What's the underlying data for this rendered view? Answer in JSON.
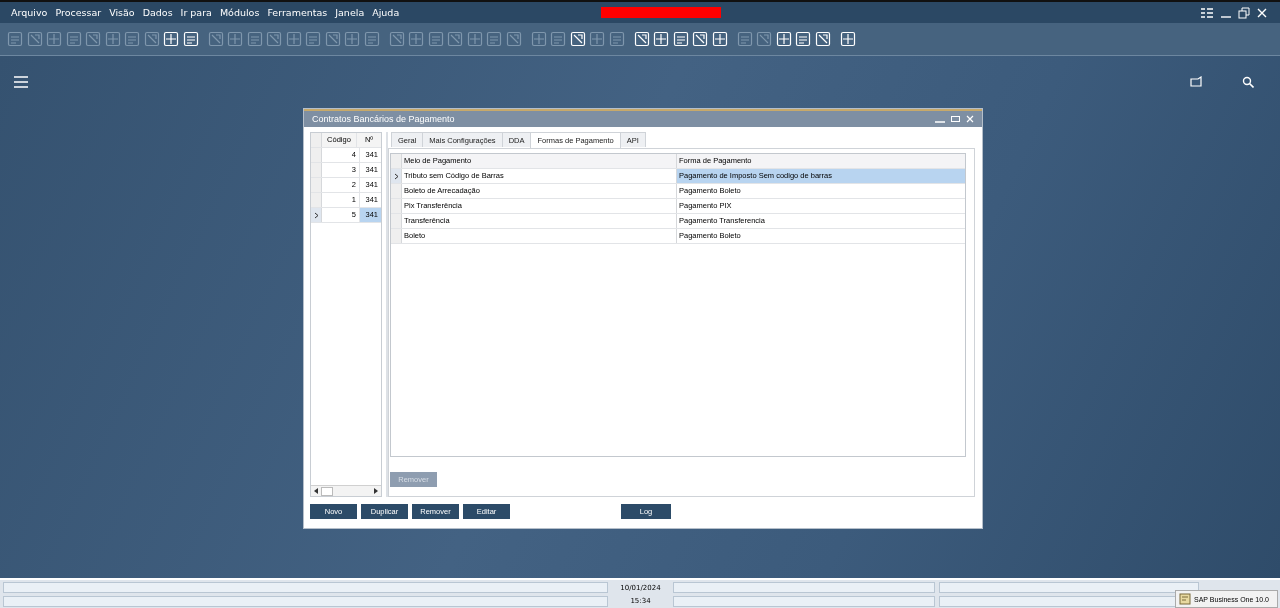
{
  "menu_bar": {
    "items": [
      "Arquivo",
      "Processar",
      "Visão",
      "Dados",
      "Ir para",
      "Módulos",
      "Ferramentas",
      "Janela",
      "Ajuda"
    ]
  },
  "toolbar": {
    "buttons": [
      {
        "disabled": true
      },
      {
        "disabled": true
      },
      {
        "disabled": true
      },
      {
        "disabled": true
      },
      {
        "disabled": true
      },
      {
        "disabled": true
      },
      {
        "disabled": true
      },
      {
        "disabled": true
      },
      {
        "disabled": false
      },
      {
        "disabled": false
      },
      {
        "disabled": true
      },
      {
        "disabled": true
      },
      {
        "disabled": true
      },
      {
        "disabled": true
      },
      {
        "disabled": true
      },
      {
        "disabled": true
      },
      {
        "disabled": true
      },
      {
        "disabled": true
      },
      {
        "disabled": true
      },
      {
        "disabled": true
      },
      {
        "disabled": true
      },
      {
        "disabled": true
      },
      {
        "disabled": true
      },
      {
        "disabled": true
      },
      {
        "disabled": true
      },
      {
        "disabled": true
      },
      {
        "disabled": true
      },
      {
        "disabled": true
      },
      {
        "disabled": false
      },
      {
        "disabled": true
      },
      {
        "disabled": true
      },
      {
        "disabled": false
      },
      {
        "disabled": false
      },
      {
        "disabled": false
      },
      {
        "disabled": false
      },
      {
        "disabled": false
      },
      {
        "disabled": true
      },
      {
        "disabled": true
      },
      {
        "disabled": false
      },
      {
        "disabled": false
      },
      {
        "disabled": false
      },
      {
        "disabled": false
      }
    ]
  },
  "window": {
    "title": "Contratos Bancários de Pagamento",
    "contracts": {
      "columns": [
        "Código",
        "Nº"
      ],
      "rows": [
        {
          "code": "4",
          "number": "341",
          "selected": false
        },
        {
          "code": "3",
          "number": "341",
          "selected": false
        },
        {
          "code": "2",
          "number": "341",
          "selected": false
        },
        {
          "code": "1",
          "number": "341",
          "selected": false
        },
        {
          "code": "5",
          "number": "341",
          "selected": true
        }
      ]
    },
    "tabs": [
      {
        "label": "Geral",
        "selected": false
      },
      {
        "label": "Mais Configurações",
        "selected": false
      },
      {
        "label": "DDA",
        "selected": false
      },
      {
        "label": "Formas de Pagamento",
        "selected": true
      },
      {
        "label": "API",
        "selected": false
      }
    ],
    "payment_table": {
      "columns": [
        "Meio de Pagamento",
        "Forma de Pagamento"
      ],
      "rows": [
        {
          "meio": "Tributo sem Código de Barras",
          "forma": "Pagamento de Imposto Sem codigo de barras",
          "selected": true
        },
        {
          "meio": "Boleto de Arrecadação",
          "forma": "Pagamento Boleto",
          "selected": false
        },
        {
          "meio": "Pix Transferência",
          "forma": "Pagamento PIX",
          "selected": false
        },
        {
          "meio": "Transferência",
          "forma": "Pagamento Transferencia",
          "selected": false
        },
        {
          "meio": "Boleto",
          "forma": "Pagamento Boleto",
          "selected": false
        }
      ]
    },
    "tab_button": {
      "label": "Remover",
      "disabled": true
    },
    "buttons": [
      "Novo",
      "Duplicar",
      "Remover",
      "Editar"
    ],
    "log_button": "Log"
  },
  "status_bar": {
    "date": "10/01/2024",
    "time": "15:34"
  },
  "taskbar_item": "SAP Business One 10.0"
}
